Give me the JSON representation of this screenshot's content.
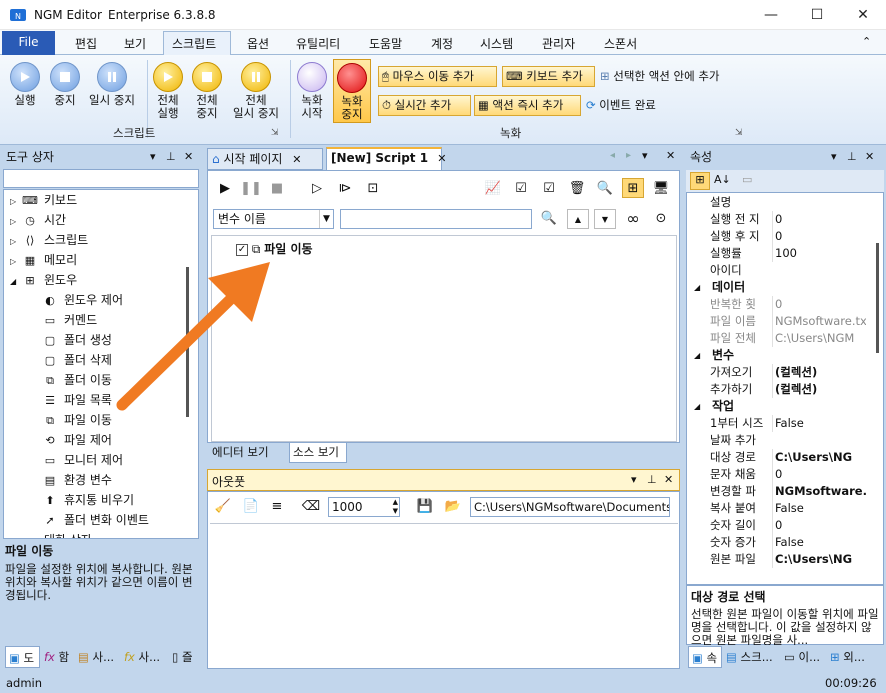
{
  "window": {
    "app_name": "NGM Editor",
    "edition": "Enterprise 6.3.8.8"
  },
  "menu": {
    "file": "File",
    "items": [
      "편집",
      "보기",
      "스크립트",
      "옵션",
      "유틸리티",
      "도움말",
      "계정",
      "시스템",
      "관리자",
      "스폰서"
    ]
  },
  "ribbon": {
    "run": "실행",
    "stop": "중지",
    "pause": "일시 중지",
    "run_all": [
      "전체",
      "실행"
    ],
    "stop_all": [
      "전체",
      "중지"
    ],
    "pause_all": [
      "전체",
      "일시 중지"
    ],
    "group_script": "스크립트",
    "rec_start": [
      "녹화",
      "시작"
    ],
    "rec_stop": [
      "녹화",
      "중지"
    ],
    "add_mouse": "마우스 이동 추가",
    "add_keyboard": "키보드 추가",
    "add_inside": "선택한 액션 안에 추가",
    "add_time": "실시간 추가",
    "add_action_now": "액션 즉시 추가",
    "event_done": "이벤트 완료",
    "group_record": "녹화"
  },
  "toolbox": {
    "title": "도구 상자",
    "items": [
      {
        "label": "키보드",
        "icon": "keyboard-icon"
      },
      {
        "label": "시간",
        "icon": "clock-icon"
      },
      {
        "label": "스크립트",
        "icon": "script-icon"
      },
      {
        "label": "메모리",
        "icon": "memory-icon"
      },
      {
        "label": "윈도우",
        "icon": "windows-icon"
      }
    ],
    "children": [
      {
        "label": "윈도우 제어",
        "icon": "window-control-icon"
      },
      {
        "label": "커멘드",
        "icon": "command-icon"
      },
      {
        "label": "폴더 생성",
        "icon": "folder-icon"
      },
      {
        "label": "폴더 삭제",
        "icon": "folder-icon"
      },
      {
        "label": "폴더 이동",
        "icon": "move-icon"
      },
      {
        "label": "파일 목록",
        "icon": "file-list-icon"
      },
      {
        "label": "파일 이동",
        "icon": "move-icon"
      },
      {
        "label": "파일 제어",
        "icon": "file-control-icon"
      },
      {
        "label": "모니터 제어",
        "icon": "monitor-icon"
      },
      {
        "label": "환경 변수",
        "icon": "environment-icon"
      },
      {
        "label": "휴지통 비우기",
        "icon": "recycle-icon"
      },
      {
        "label": "폴더 변화 이벤트",
        "icon": "folder-event-icon"
      }
    ],
    "partial_item": "대화 상자",
    "desc_title": "파일 이동",
    "desc_text": "파일을 설정한 위치에 복사합니다. 원본 위치와 복사할 위치가 같으면 이름이 변경됩니다.",
    "bottom_tabs": [
      "도",
      "함",
      "사...",
      "사...",
      "즐"
    ]
  },
  "editor": {
    "tab_start": "시작 페이지",
    "tab_script": "[New] Script 1",
    "var_combo": "변수 이름",
    "action_label": "파일 이동",
    "view_editor": "에디터 보기",
    "view_source": "소스 보기"
  },
  "output": {
    "title": "아웃풋",
    "delay_value": "1000",
    "path": "C:\\Users\\NGMsoftware\\Documents\\"
  },
  "props": {
    "title": "속성",
    "rows": [
      {
        "name": "설명",
        "value": "",
        "bold": false,
        "gray": false
      },
      {
        "name": "실행 전 지",
        "value": "0",
        "bold": false,
        "gray": false
      },
      {
        "name": "실행 후 지",
        "value": "0",
        "bold": false,
        "gray": false
      },
      {
        "name": "실행률",
        "value": "100",
        "bold": false,
        "gray": false
      },
      {
        "name": "아이디",
        "value": "",
        "bold": false,
        "gray": false
      },
      {
        "cat": "데이터"
      },
      {
        "name": "반복한 횟",
        "value": "0",
        "bold": false,
        "gray": true
      },
      {
        "name": "파일 이름",
        "value": "NGMsoftware.txt",
        "bold": false,
        "gray": true
      },
      {
        "name": "파일 전체",
        "value": "C:\\Users\\NGM",
        "bold": false,
        "gray": true
      },
      {
        "cat": "변수"
      },
      {
        "name": "가져오기",
        "value": "(컬렉션)",
        "bold": true,
        "gray": false
      },
      {
        "name": "추가하기",
        "value": "(컬렉션)",
        "bold": true,
        "gray": false
      },
      {
        "cat": "작업"
      },
      {
        "name": "1부터 시즈",
        "value": "False",
        "bold": false,
        "gray": false
      },
      {
        "name": "날짜 추가",
        "value": "",
        "bold": false,
        "gray": false
      },
      {
        "name": "대상 경로",
        "value": "C:\\Users\\NG",
        "bold": true,
        "gray": false
      },
      {
        "name": "문자 채움",
        "value": "0",
        "bold": false,
        "gray": false
      },
      {
        "name": "변경할 파",
        "value": "NGMsoftware.t",
        "bold": true,
        "gray": false
      },
      {
        "name": "복사 붙여",
        "value": "False",
        "bold": false,
        "gray": false
      },
      {
        "name": "숫자 길이",
        "value": "0",
        "bold": false,
        "gray": false
      },
      {
        "name": "숫자 증가",
        "value": "False",
        "bold": false,
        "gray": false
      },
      {
        "name": "원본 파일",
        "value": "C:\\Users\\NG",
        "bold": true,
        "gray": false
      }
    ],
    "desc_title": "대상 경로 선택",
    "desc_text": "선택한 원본 파일이 이동할 위치에 파일명을 선택합니다. 이 값을 설정하지 않으면 원본 파일명을 사...",
    "bottom_tabs": [
      "속",
      "스크...",
      "이...",
      "외..."
    ]
  },
  "status": {
    "user": "admin",
    "time": "00:09:26"
  },
  "colors": {
    "accent": "#2a5bb6",
    "arrow": "#f07a22",
    "panel_bg": "#c2d6ec"
  }
}
